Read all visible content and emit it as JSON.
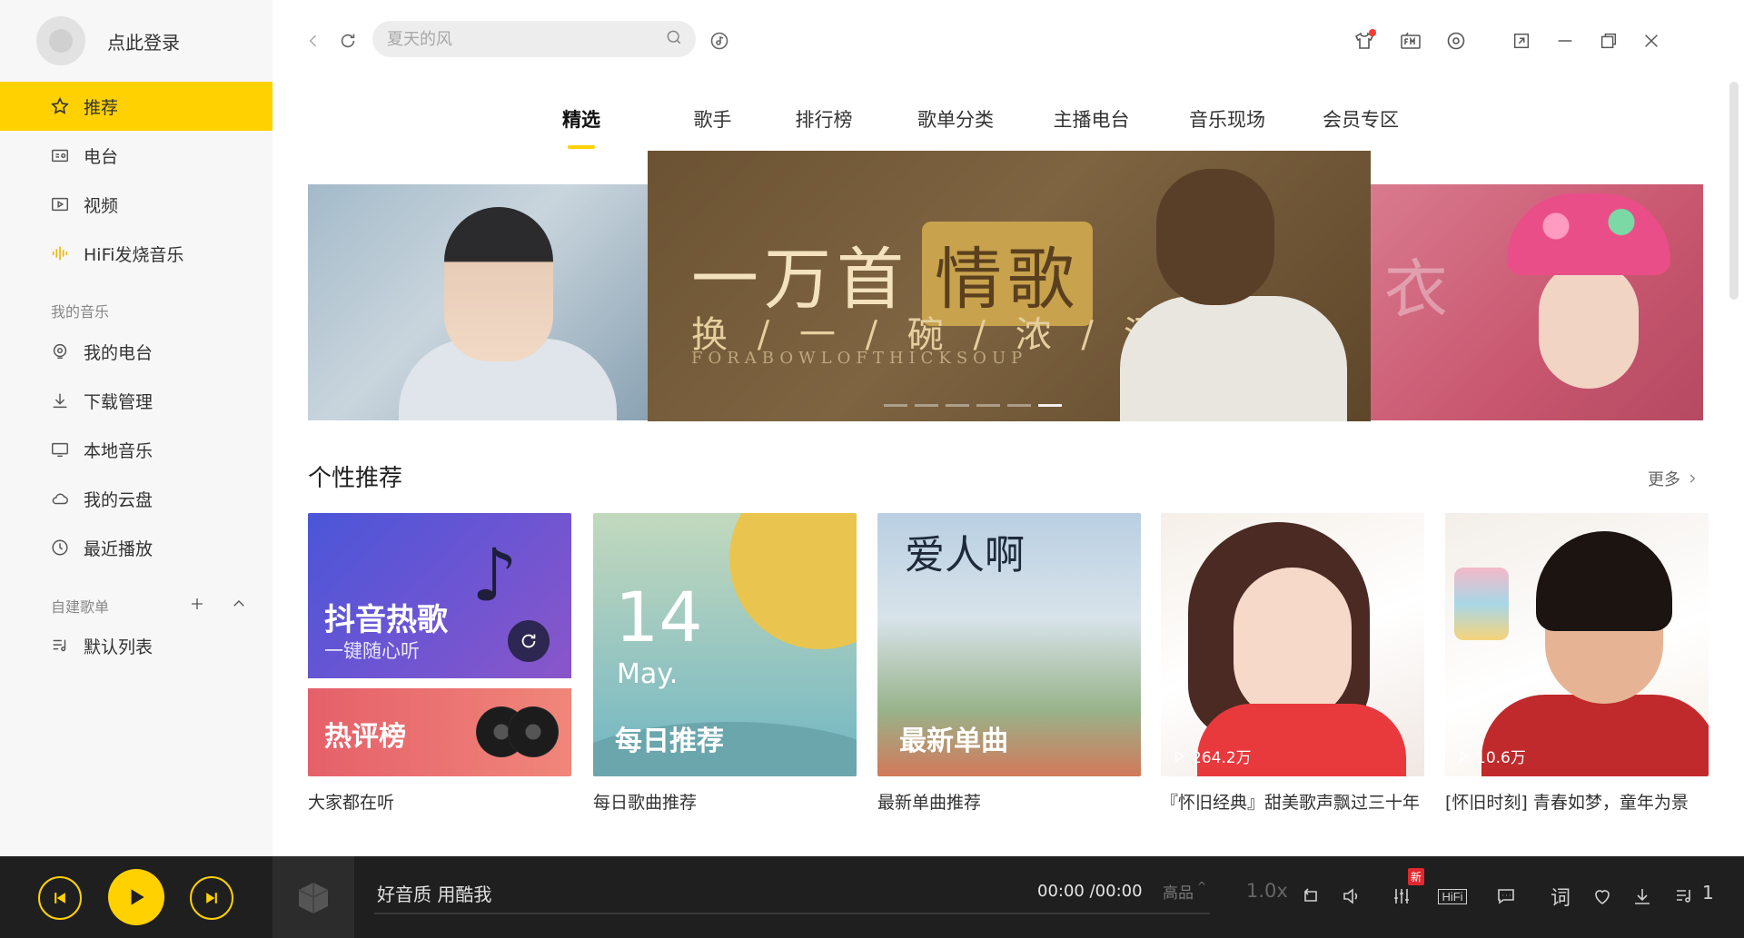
{
  "user": {
    "login_text": "点此登录"
  },
  "sidebar": {
    "main_items": [
      {
        "label": "推荐",
        "icon": "star-icon",
        "active": true
      },
      {
        "label": "电台",
        "icon": "radio-icon"
      },
      {
        "label": "视频",
        "icon": "video-icon"
      },
      {
        "label": "HiFi发烧音乐",
        "icon": "soundwave-icon"
      }
    ],
    "my_music_title": "我的音乐",
    "my_music_items": [
      {
        "label": "我的电台",
        "icon": "podcast-icon"
      },
      {
        "label": "下载管理",
        "icon": "download-icon"
      },
      {
        "label": "本地音乐",
        "icon": "monitor-icon"
      },
      {
        "label": "我的云盘",
        "icon": "cloud-icon"
      },
      {
        "label": "最近播放",
        "icon": "clock-icon"
      }
    ],
    "playlists_title": "自建歌单",
    "playlists": [
      {
        "label": "默认列表",
        "icon": "playlist-icon"
      }
    ]
  },
  "search": {
    "placeholder": "夏天的风"
  },
  "tabs": [
    {
      "label": "精选",
      "active": true
    },
    {
      "label": "歌手"
    },
    {
      "label": "排行榜"
    },
    {
      "label": "歌单分类"
    },
    {
      "label": "主播电台"
    },
    {
      "label": "音乐现场"
    },
    {
      "label": "会员专区"
    }
  ],
  "banner": {
    "title_main": "一万首",
    "title_highlight": "情歌",
    "subtitle": "换 / 一 / 碗 / 浓 / 汤",
    "subtitle_en": "FORABOWLOFTHICKSOUP",
    "right_calligraphy": "衣",
    "slide_count": 6,
    "active_slide": 5
  },
  "recommend": {
    "title": "个性推荐",
    "more": "更多",
    "cards": [
      {
        "cover_title": "抖音热歌",
        "cover_subtitle": "一键随心听",
        "cover_title_2": "热评榜",
        "caption": "大家都在听"
      },
      {
        "day": "14",
        "month": "May.",
        "cover_title": "每日推荐",
        "caption": "每日歌曲推荐"
      },
      {
        "calligraphy": "爱人啊",
        "cover_title": "最新单曲",
        "caption": "最新单曲推荐"
      },
      {
        "play_count": "264.2万",
        "caption": "『怀旧经典』甜美歌声飘过三十年"
      },
      {
        "play_count": "10.6万",
        "caption": "[怀旧时刻] 青春如梦，童年为景"
      }
    ]
  },
  "player": {
    "title": "好音质 用酷我",
    "time": "00:00 /00:00",
    "quality": "高品",
    "speed": "1.0x",
    "new_badge": "新",
    "hifi_label": "HiFi",
    "lyrics_label": "词",
    "playlist_count": "1"
  },
  "colors": {
    "accent": "#ffd100",
    "player_bg": "#1f1f1f",
    "sidebar_bg": "#f7f7f7"
  }
}
